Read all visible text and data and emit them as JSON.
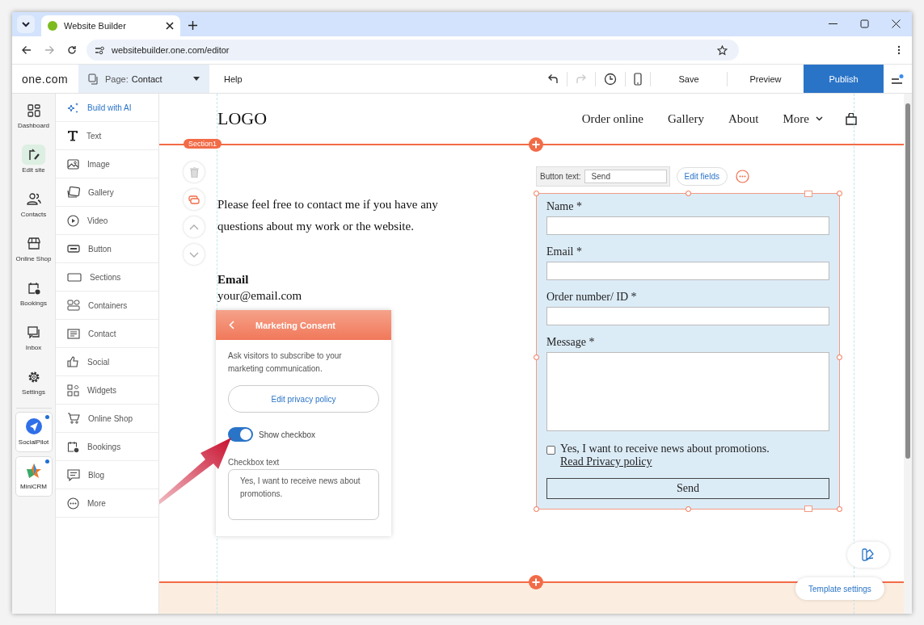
{
  "browser": {
    "tab_title": "Website Builder",
    "url": "websitebuilder.one.com/editor"
  },
  "toolbar": {
    "logo": "one.com",
    "page_label": "Page:",
    "page_name": "Contact",
    "help": "Help",
    "save": "Save",
    "preview": "Preview",
    "publish": "Publish"
  },
  "rail": {
    "items": [
      {
        "label": "Dashboard",
        "selected": false
      },
      {
        "label": "Edit site",
        "selected": true
      },
      {
        "label": "Contacts",
        "selected": false
      },
      {
        "label": "Online Shop",
        "selected": false
      },
      {
        "label": "Bookings",
        "selected": false
      },
      {
        "label": "Inbox",
        "selected": false
      },
      {
        "label": "Settings",
        "selected": false
      }
    ],
    "apps": [
      {
        "label": "SocialPilot",
        "notification": true
      },
      {
        "label": "MiniCRM",
        "notification": true
      }
    ]
  },
  "panel": {
    "items": [
      {
        "label": "Build with AI",
        "kind": "ai"
      },
      {
        "label": "Text",
        "kind": "text"
      },
      {
        "label": "Image",
        "kind": "image"
      },
      {
        "label": "Gallery",
        "kind": "gallery"
      },
      {
        "label": "Video",
        "kind": "video"
      },
      {
        "label": "Button",
        "kind": "button"
      },
      {
        "label": "Sections",
        "kind": "sections"
      },
      {
        "label": "Containers",
        "kind": "containers"
      },
      {
        "label": "Contact",
        "kind": "contact"
      },
      {
        "label": "Social",
        "kind": "social"
      },
      {
        "label": "Widgets",
        "kind": "widgets"
      },
      {
        "label": "Online Shop",
        "kind": "shop"
      },
      {
        "label": "Bookings",
        "kind": "bookings"
      },
      {
        "label": "Blog",
        "kind": "blog"
      },
      {
        "label": "More",
        "kind": "more"
      }
    ]
  },
  "site": {
    "logo": "LOGO",
    "nav": [
      "Order online",
      "Gallery",
      "About"
    ],
    "more": "More",
    "section_label": "Section1",
    "intro": "Please feel free to contact me if you have any questions about my work or the website.",
    "email_heading": "Email",
    "email_value": "your@email.com"
  },
  "form_toolbar": {
    "label": "Button text:",
    "value": "Send",
    "edit_fields": "Edit fields"
  },
  "form": {
    "fields": [
      {
        "label": "Name *",
        "kind": "input"
      },
      {
        "label": "Email *",
        "kind": "input"
      },
      {
        "label": "Order number/ ID *",
        "kind": "input"
      },
      {
        "label": "Message *",
        "kind": "textarea"
      }
    ],
    "consent": {
      "checked": false,
      "text": "Yes, I want to receive news about promotions.",
      "link": "Read Privacy policy"
    },
    "submit": "Send"
  },
  "popup": {
    "title": "Marketing Consent",
    "description": "Ask visitors to subscribe to your marketing communication.",
    "policy_button": "Edit privacy policy",
    "toggle": {
      "label": "Show checkbox",
      "on": true
    },
    "checkbox_text_label": "Checkbox text",
    "checkbox_text_value": "Yes, I want to receive news about promotions."
  },
  "template_settings": "Template settings"
}
